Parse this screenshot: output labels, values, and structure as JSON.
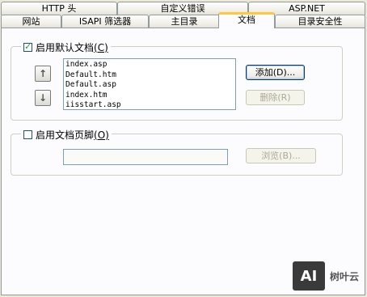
{
  "tabs_row1": [
    {
      "label": "HTTP 头"
    },
    {
      "label": "自定义错误"
    },
    {
      "label": "ASP.NET"
    }
  ],
  "tabs_row2": [
    {
      "label": "网站"
    },
    {
      "label": "ISAPI 筛选器"
    },
    {
      "label": "主目录"
    },
    {
      "label": "文档",
      "active": true
    },
    {
      "label": "目录安全性"
    }
  ],
  "default_doc": {
    "checkbox_label": "启用默认文档",
    "checkbox_shortcut": "(C)",
    "checked": true,
    "move_up_icon": "arrow-up-icon",
    "move_down_icon": "arrow-down-icon",
    "documents": [
      "index.asp",
      "Default.htm",
      "Default.asp",
      "index.htm",
      "iisstart.asp"
    ],
    "add_button": "添加(D)...",
    "remove_button": "删除(R)"
  },
  "footer": {
    "checkbox_label": "启用文档页脚",
    "checkbox_shortcut": "(O)",
    "checked": false,
    "path_value": "",
    "browse_button": "浏览(B)..."
  },
  "watermark": {
    "logo": "AI",
    "text": "树叶云"
  }
}
